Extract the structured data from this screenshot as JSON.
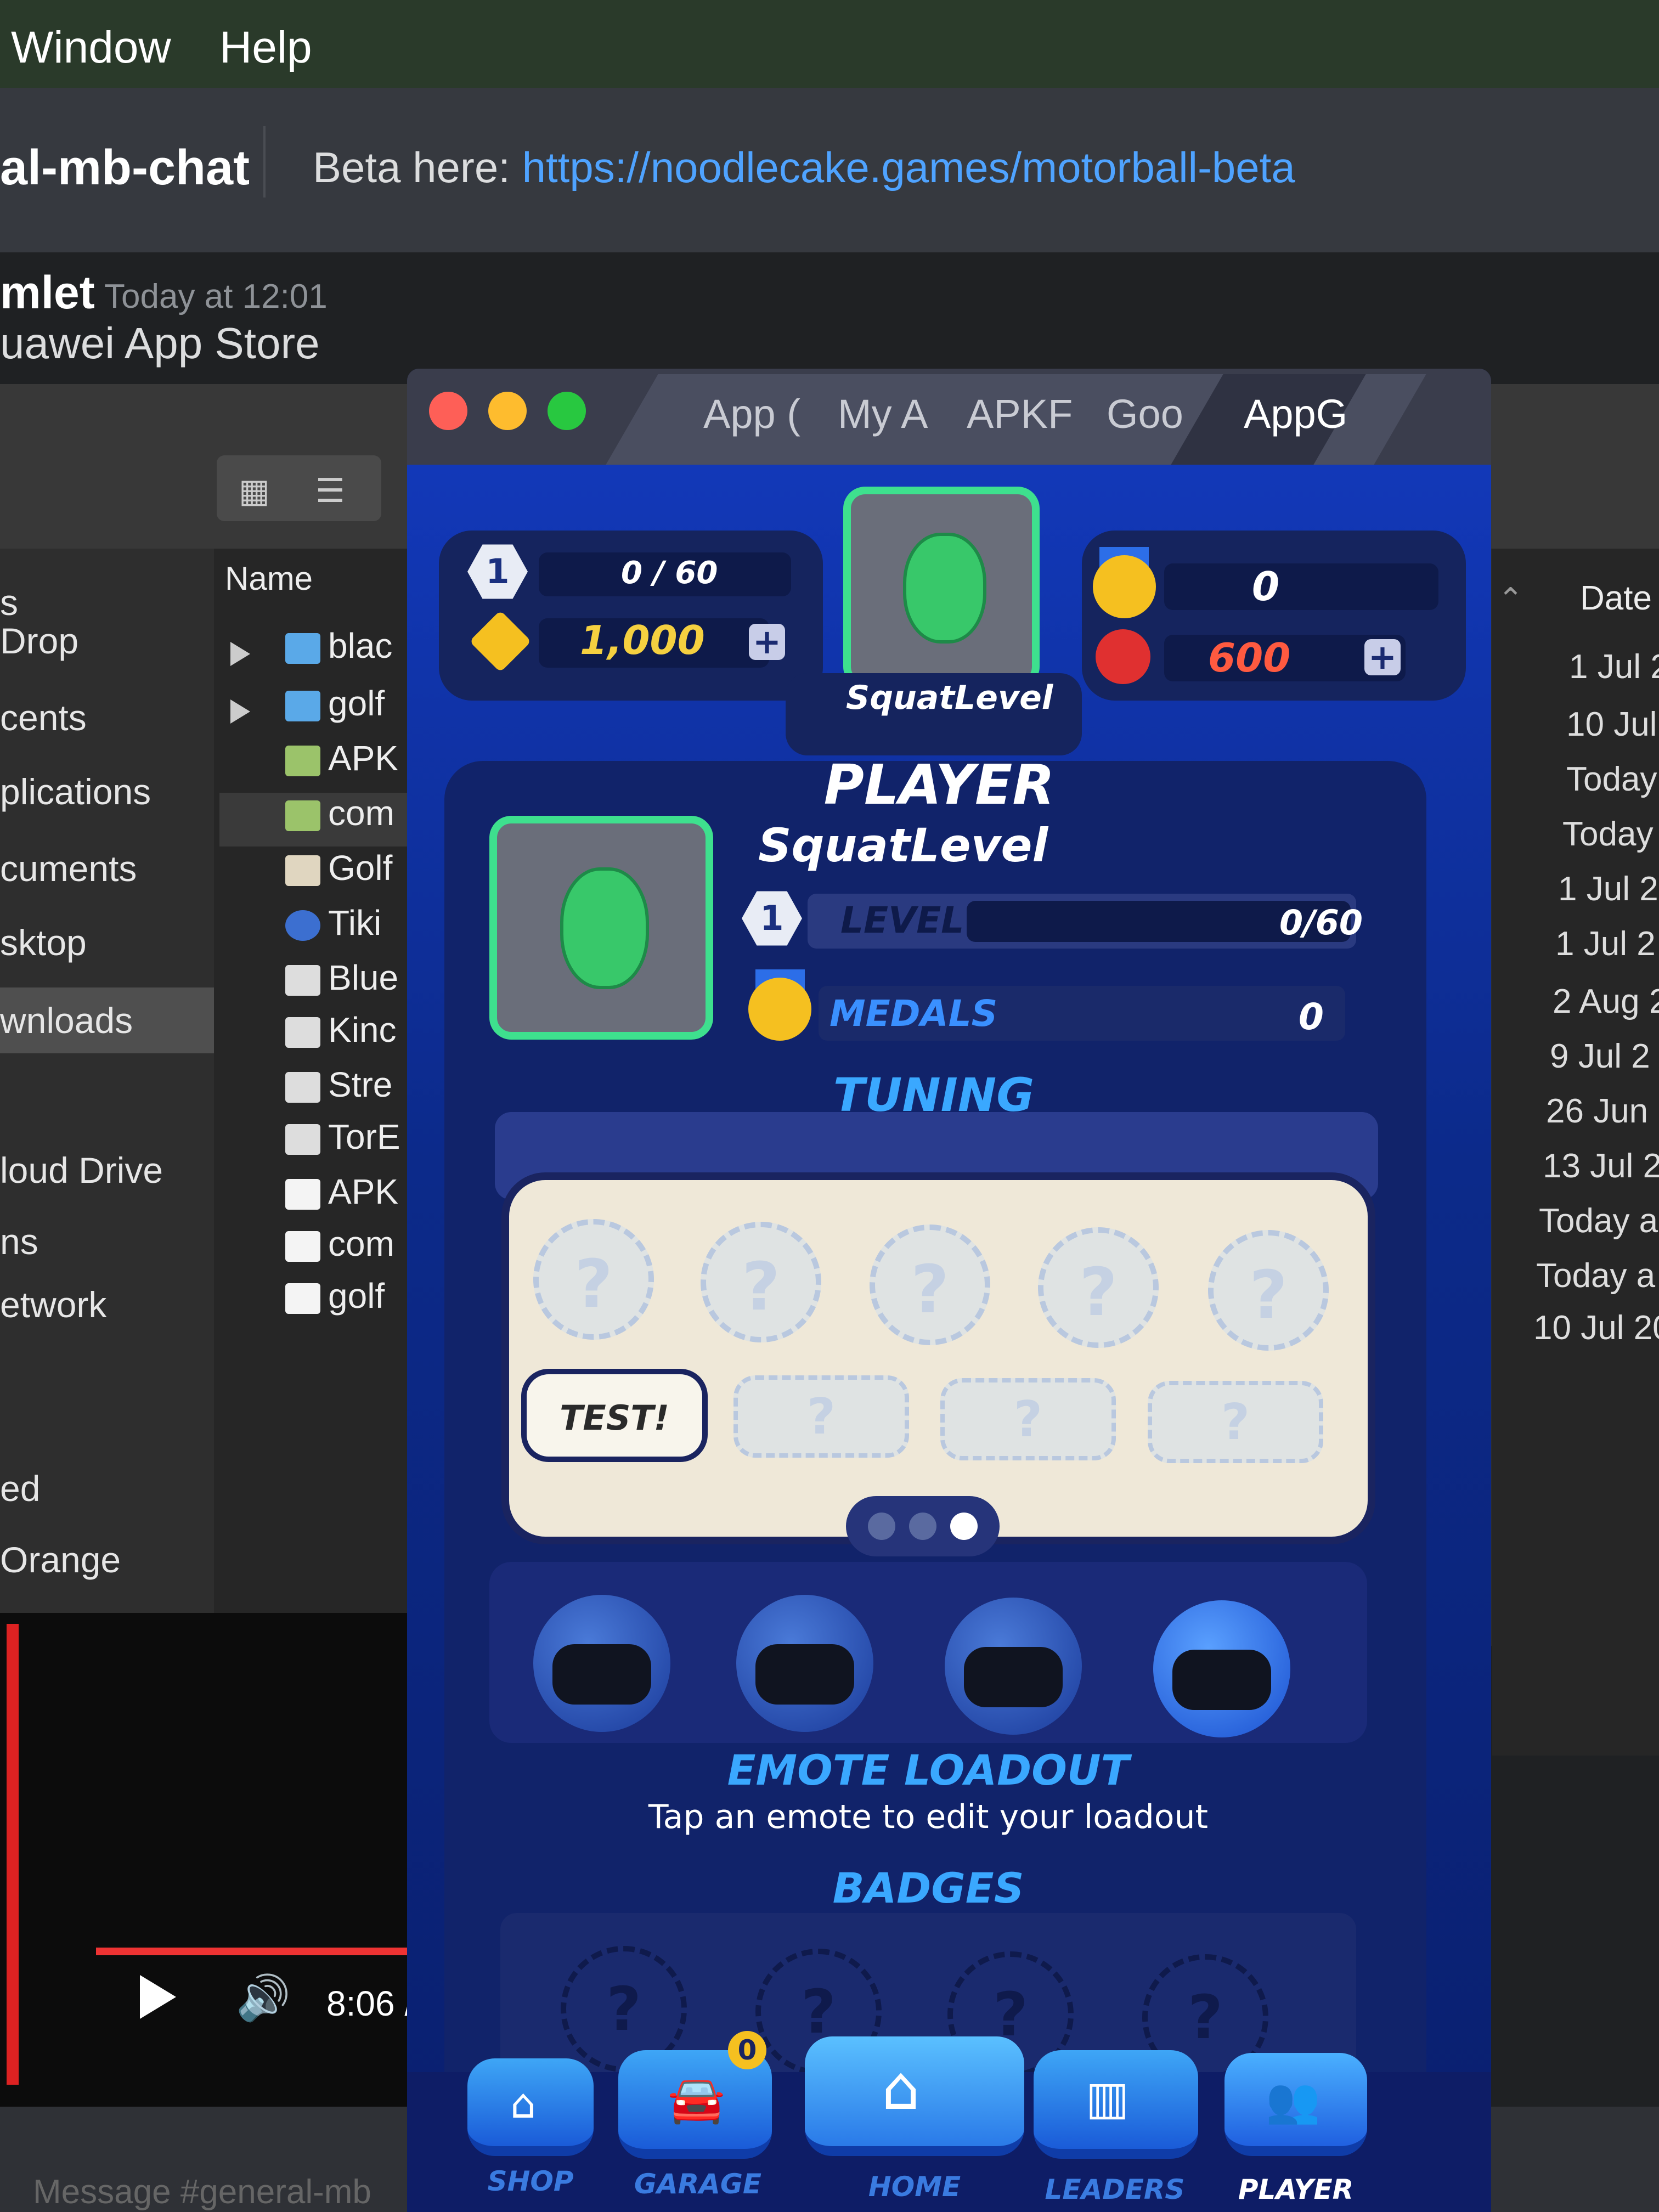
{
  "menubar": {
    "items": [
      "Window",
      "Help"
    ]
  },
  "discord": {
    "channel": "al-mb-chat",
    "beta_prefix": "Beta here: ",
    "beta_link": "https://noodlecake.games/motorball-beta",
    "author": "mlet",
    "time": "Today at 12:01",
    "message": "uawei App Store",
    "input_placeholder": "Message #general-mb"
  },
  "finder": {
    "sidebar": [
      "s",
      "Drop",
      "cents",
      "plications",
      "cuments",
      "sktop",
      "wnloads",
      "loud Drive",
      "ns",
      "etwork",
      "ed",
      "Orange"
    ],
    "name_header": "Name",
    "date_header": "Date",
    "files": [
      "blac",
      "golf",
      "APK",
      "com",
      "Golf",
      "Tiki",
      "Blue",
      "Kinc",
      "Stre",
      "TorE",
      "APK",
      "com",
      "golf"
    ],
    "dates": [
      "1 Jul 2",
      "10 Jul",
      "Today",
      "Today",
      "1 Jul 2",
      "1 Jul 2",
      "2 Aug 2",
      "9 Jul 2",
      "26 Jun",
      "13 Jul 2",
      "Today a",
      "Today a",
      "10 Jul 20"
    ]
  },
  "video": {
    "time": "8:06 /"
  },
  "game_window": {
    "tabs": [
      "App (",
      "My A",
      "APKF",
      "Goo",
      "AppG"
    ]
  },
  "game": {
    "hud": {
      "level": "1",
      "xp": "0 / 60",
      "coins": "1,000",
      "medals": "0",
      "gems": "600",
      "player_name": "SquatLevel",
      "plus": "+"
    },
    "player": {
      "title": "PLAYER",
      "name": "SquatLevel",
      "level_num": "1",
      "level_label": "LEVEL",
      "level_value": "0/60",
      "level_progress": 0,
      "medals_label": "MEDALS",
      "medals_value": "0"
    },
    "tuning": {
      "title": "TUNING"
    },
    "emote_panel": {
      "test_label": "TEST!",
      "q": "?"
    },
    "emote_loadout": {
      "title": "EMOTE LOADOUT",
      "subtitle": "Tap an emote to edit your loadout"
    },
    "badges": {
      "title": "BADGES"
    },
    "nav": [
      {
        "label": "SHOP"
      },
      {
        "label": "GARAGE",
        "badge": "0"
      },
      {
        "label": "HOME"
      },
      {
        "label": "LEADERS"
      },
      {
        "label": "PLAYER"
      }
    ]
  },
  "colors": {
    "accent_green": "#3ee08e",
    "gold": "#f5c020",
    "gem_red": "#e03030",
    "game_blue": "#1238b8"
  }
}
